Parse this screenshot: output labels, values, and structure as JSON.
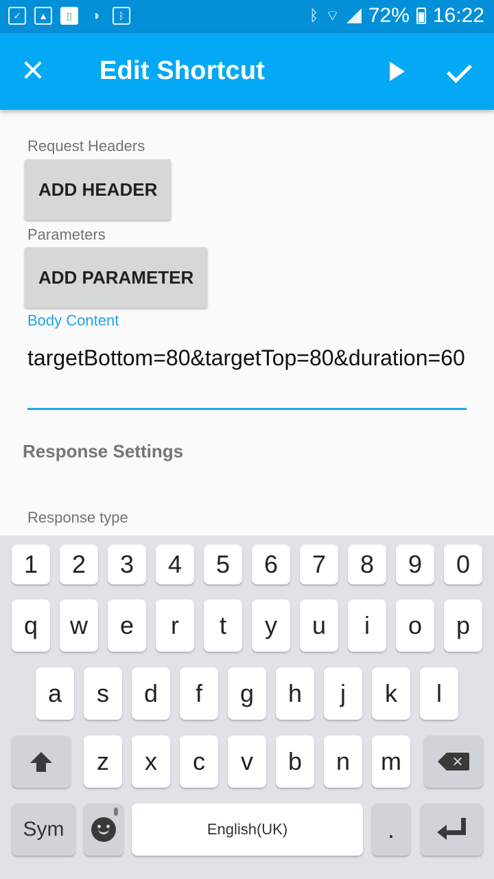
{
  "status_bar": {
    "battery": "72%",
    "time": "16:22",
    "left_icons": [
      "clipboard-icon",
      "gallery-icon",
      "vibrate-icon",
      "contrast-icon",
      "bluetooth-app-icon"
    ],
    "right_icons": [
      "bluetooth-icon",
      "wifi-icon",
      "signal-icon",
      "battery-icon"
    ]
  },
  "app_bar": {
    "title": "Edit Shortcut",
    "close_icon": "close-icon",
    "run_icon": "play-icon",
    "save_icon": "check-icon",
    "color": "#03a9f4"
  },
  "form": {
    "request_headers_label": "Request Headers",
    "add_header_label": "ADD HEADER",
    "parameters_label": "Parameters",
    "add_parameter_label": "ADD PARAMETER",
    "body_content_label": "Body Content",
    "body_content_value": "targetBottom=80&targetTop=80&duration=60",
    "response_settings_title": "Response Settings",
    "response_type_label": "Response type"
  },
  "keyboard": {
    "row_numbers": [
      "1",
      "2",
      "3",
      "4",
      "5",
      "6",
      "7",
      "8",
      "9",
      "0"
    ],
    "row_top": [
      "q",
      "w",
      "e",
      "r",
      "t",
      "y",
      "u",
      "i",
      "o",
      "p"
    ],
    "row_middle": [
      "a",
      "s",
      "d",
      "f",
      "g",
      "h",
      "j",
      "k",
      "l"
    ],
    "row_bottom": [
      "z",
      "x",
      "c",
      "v",
      "b",
      "n",
      "m"
    ],
    "sym_label": "Sym",
    "space_label": "English(UK)",
    "period_label": "."
  },
  "colors": {
    "accent": "#1ea6ea",
    "status_bar": "#0390d8",
    "keyboard_bg": "#e0e2e6"
  }
}
